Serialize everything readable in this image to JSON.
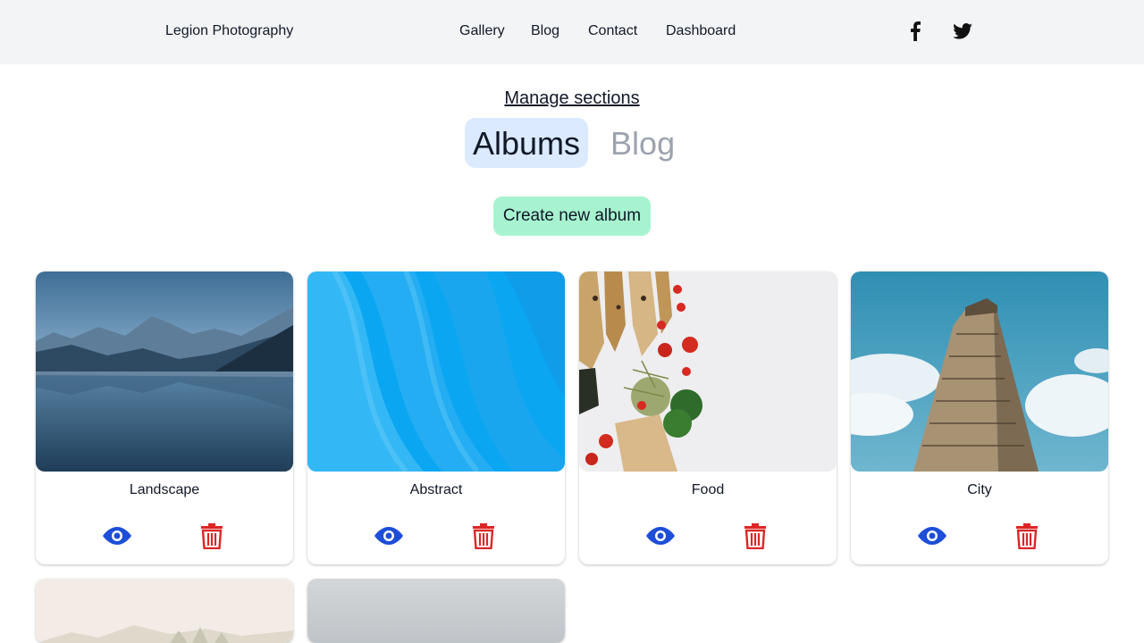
{
  "header": {
    "brand": "Legion Photography",
    "nav": [
      {
        "label": "Gallery"
      },
      {
        "label": "Blog"
      },
      {
        "label": "Contact"
      },
      {
        "label": "Dashboard"
      }
    ],
    "social": [
      {
        "icon": "facebook-icon"
      },
      {
        "icon": "twitter-icon"
      }
    ]
  },
  "manage": {
    "title": "Manage sections",
    "tabs": [
      {
        "label": "Albums",
        "active": true
      },
      {
        "label": "Blog",
        "active": false
      }
    ],
    "create_button": "Create new album"
  },
  "albums": [
    {
      "title": "Landscape",
      "actions": [
        "eye-icon",
        "trash-icon"
      ]
    },
    {
      "title": "Abstract",
      "actions": [
        "eye-icon",
        "trash-icon"
      ]
    },
    {
      "title": "Food",
      "actions": [
        "eye-icon",
        "trash-icon"
      ]
    },
    {
      "title": "City",
      "actions": [
        "eye-icon",
        "trash-icon"
      ]
    },
    {
      "title": "",
      "actions": []
    },
    {
      "title": "",
      "actions": []
    }
  ],
  "colors": {
    "header_bg": "#f3f4f6",
    "active_tab_bg": "#dbeafe",
    "create_button_bg": "#a7f3d0",
    "view_icon": "#1d4ed8",
    "delete_icon": "#dc2626"
  }
}
